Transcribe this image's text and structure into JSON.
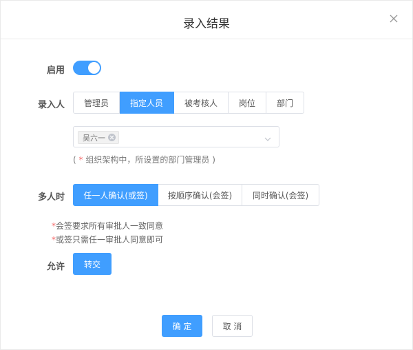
{
  "dialog": {
    "title": "录入结果"
  },
  "enable": {
    "label": "启用",
    "on": true
  },
  "recorder": {
    "label": "录入人",
    "options": [
      {
        "label": "管理员",
        "active": false
      },
      {
        "label": "指定人员",
        "active": true
      },
      {
        "label": "被考核人",
        "active": false
      },
      {
        "label": "岗位",
        "active": false
      },
      {
        "label": "部门",
        "active": false
      }
    ],
    "selected_tag": "吴六一",
    "hint_open": "(",
    "hint_star": "*",
    "hint_text": "组织架构中，所设置的部门管理员",
    "hint_close": ")"
  },
  "multi": {
    "label": "多人时",
    "options": [
      {
        "label": "任一人确认(或签)",
        "active": true
      },
      {
        "label": "按顺序确认(会签)",
        "active": false
      },
      {
        "label": "同时确认(会签)",
        "active": false
      }
    ],
    "note1_star": "*",
    "note1_text": "会签要求所有审批人一致同意",
    "note2_star": "*",
    "note2_text": "或签只需任一审批人同意即可"
  },
  "allow": {
    "label": "允许",
    "button": "转交"
  },
  "footer": {
    "confirm": "确 定",
    "cancel": "取 消"
  },
  "colors": {
    "primary": "#409eff",
    "danger": "#f56c6c"
  }
}
